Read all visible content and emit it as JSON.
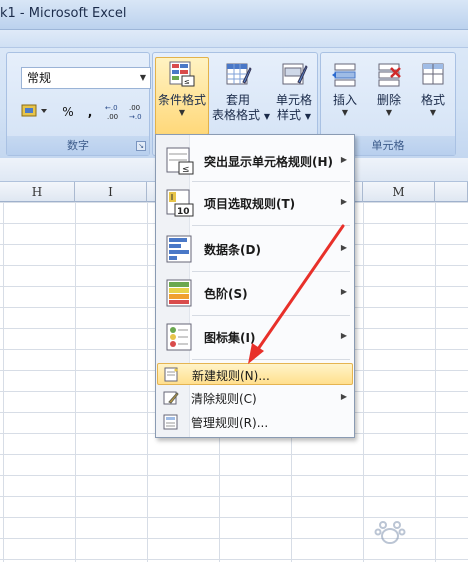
{
  "window": {
    "title": "k1 - Microsoft Excel"
  },
  "number_group": {
    "format_value": "常规",
    "label": "数字",
    "percent": "%",
    "comma": ",",
    "inc_decimal": "+.0 .00",
    "dec_decimal": ".00 +.0"
  },
  "styles_group": {
    "conditional_format": "条件格式",
    "table_format_line1": "套用",
    "table_format_line2": "表格格式",
    "cell_style_line1": "单元格",
    "cell_style_line2": "样式"
  },
  "cells_group": {
    "insert": "插入",
    "delete": "删除",
    "format": "格式",
    "label": "单元格"
  },
  "columns": [
    "H",
    "I",
    "M"
  ],
  "menu": {
    "items": [
      {
        "label": "突出显示单元格规则(H)",
        "has_submenu": true
      },
      {
        "label": "项目选取规则(T)",
        "has_submenu": true
      },
      {
        "label": "数据条(D)",
        "has_submenu": true
      },
      {
        "label": "色阶(S)",
        "has_submenu": true
      },
      {
        "label": "图标集(I)",
        "has_submenu": true
      },
      {
        "label": "新建规则(N)...",
        "has_submenu": false,
        "highlighted": true
      },
      {
        "label": "清除规则(C)",
        "has_submenu": true
      },
      {
        "label": "管理规则(R)...",
        "has_submenu": false
      }
    ],
    "submenu_arrow": "▶",
    "top10_number": "10"
  },
  "colors": {
    "highlight": "#ffdf8e",
    "arrow": "#e8302a"
  }
}
